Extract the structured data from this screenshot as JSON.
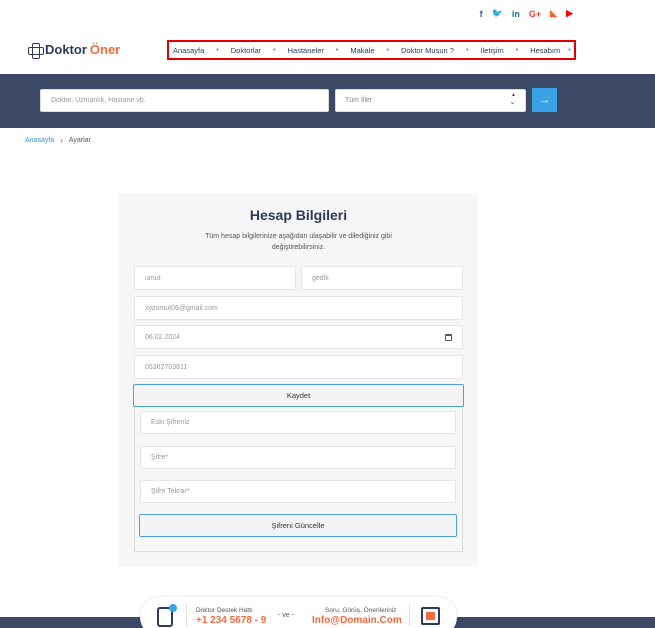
{
  "social": {
    "icons": [
      "facebook-icon",
      "twitter-icon",
      "linkedin-icon",
      "google-plus-icon",
      "rss-icon",
      "youtube-icon"
    ],
    "glyphs": {
      "facebook": "f",
      "twitter": "🐦",
      "linkedin": "in",
      "google_plus": "G+",
      "rss": "◣",
      "youtube": "▶"
    }
  },
  "logo": {
    "part1": "Doktor",
    "part2": "Öner"
  },
  "nav": {
    "items": [
      "Anasayfa",
      "Doktorlar",
      "Hastaneler",
      "Makale",
      "Doktor Musun ?",
      "İletişim",
      "Hesabım"
    ],
    "separator": "•"
  },
  "search": {
    "placeholder": "Doktor, Uzmanlık, Hastane vb.",
    "city_selected": "Tüm İller",
    "button_icon": "arrow-right-icon",
    "button_glyph": "→"
  },
  "breadcrumb": {
    "home": "Anasayfa",
    "separator": "›",
    "current": "Ayarlar"
  },
  "form": {
    "title": "Hesap Bilgileri",
    "description": "Tüm hesap bilgilerinize aşağıdan ulaşabilir ve dilediğiniz gibi değiştirebilirsiniz.",
    "first_name": "umut",
    "last_name": "gedik",
    "email": "xyzomut06@gmail.com",
    "birth_date": "06.02.2024",
    "phone": "05362703811",
    "save_label": "Kaydet",
    "old_password_placeholder": "Eski Şifreniz",
    "new_password_placeholder": "Şifre*",
    "repeat_password_placeholder": "Şifre Tekrar*",
    "update_password_label": "Şifreni Güncelle"
  },
  "footer": {
    "hotline_label": "Doktor Destek Hattı",
    "hotline_number": "+1 234 5678 - 9",
    "connector": "- ve -",
    "feedback_label": "Soru, Görüş, Önerileriniz",
    "email": "Info@Domain.Com"
  },
  "colors": {
    "navy": "#3b4866",
    "accent_orange": "#f26a3d",
    "accent_blue": "#3aa3e6",
    "highlight_red": "#e00000"
  }
}
